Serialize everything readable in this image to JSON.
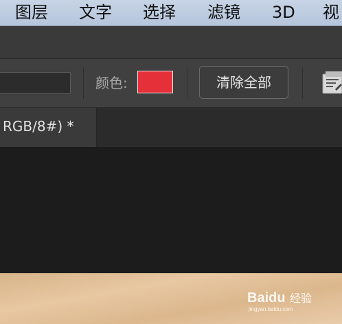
{
  "menu": {
    "items": [
      "图层",
      "文字",
      "选择",
      "滤镜",
      "3D",
      "视"
    ]
  },
  "options_bar": {
    "color_label": "颜色:",
    "color_value": "#e5303a",
    "clear_all_button": "清除全部",
    "right_icon": "document-icon"
  },
  "tab": {
    "label": "RGB/8#) *"
  },
  "watermark": {
    "brand": "Baidu",
    "brand_suffix": "经验",
    "url": "jingyan.baidu.com"
  }
}
